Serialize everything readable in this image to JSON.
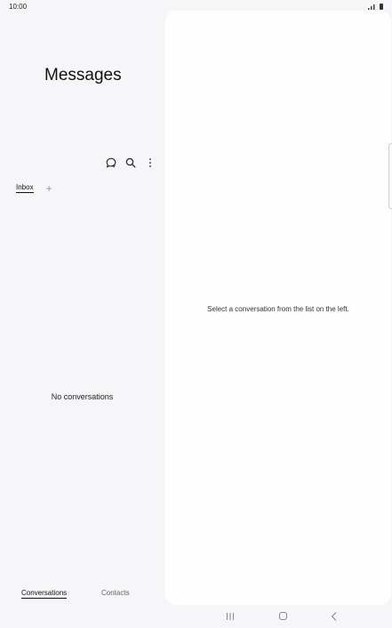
{
  "status_bar": {
    "time": "10:00"
  },
  "left_pane": {
    "title": "Messages",
    "actions": [
      {
        "name": "new-conversation-icon"
      },
      {
        "name": "search-icon"
      },
      {
        "name": "more-options-icon"
      }
    ],
    "tabs": [
      {
        "label": "Inbox",
        "selected": true
      }
    ],
    "add_tab_label": "+",
    "empty_text": "No conversations"
  },
  "right_pane": {
    "placeholder": "Select a conversation from the list on the left."
  },
  "bottom_nav": {
    "items": [
      {
        "label": "Conversations",
        "selected": true
      },
      {
        "label": "Contacts",
        "selected": false
      }
    ]
  },
  "system_nav": {
    "buttons": [
      "recents",
      "home",
      "back"
    ]
  },
  "colors": {
    "background": "#f6f6f8",
    "pane": "#fefefe",
    "text": "#111111",
    "muted": "#666666"
  }
}
